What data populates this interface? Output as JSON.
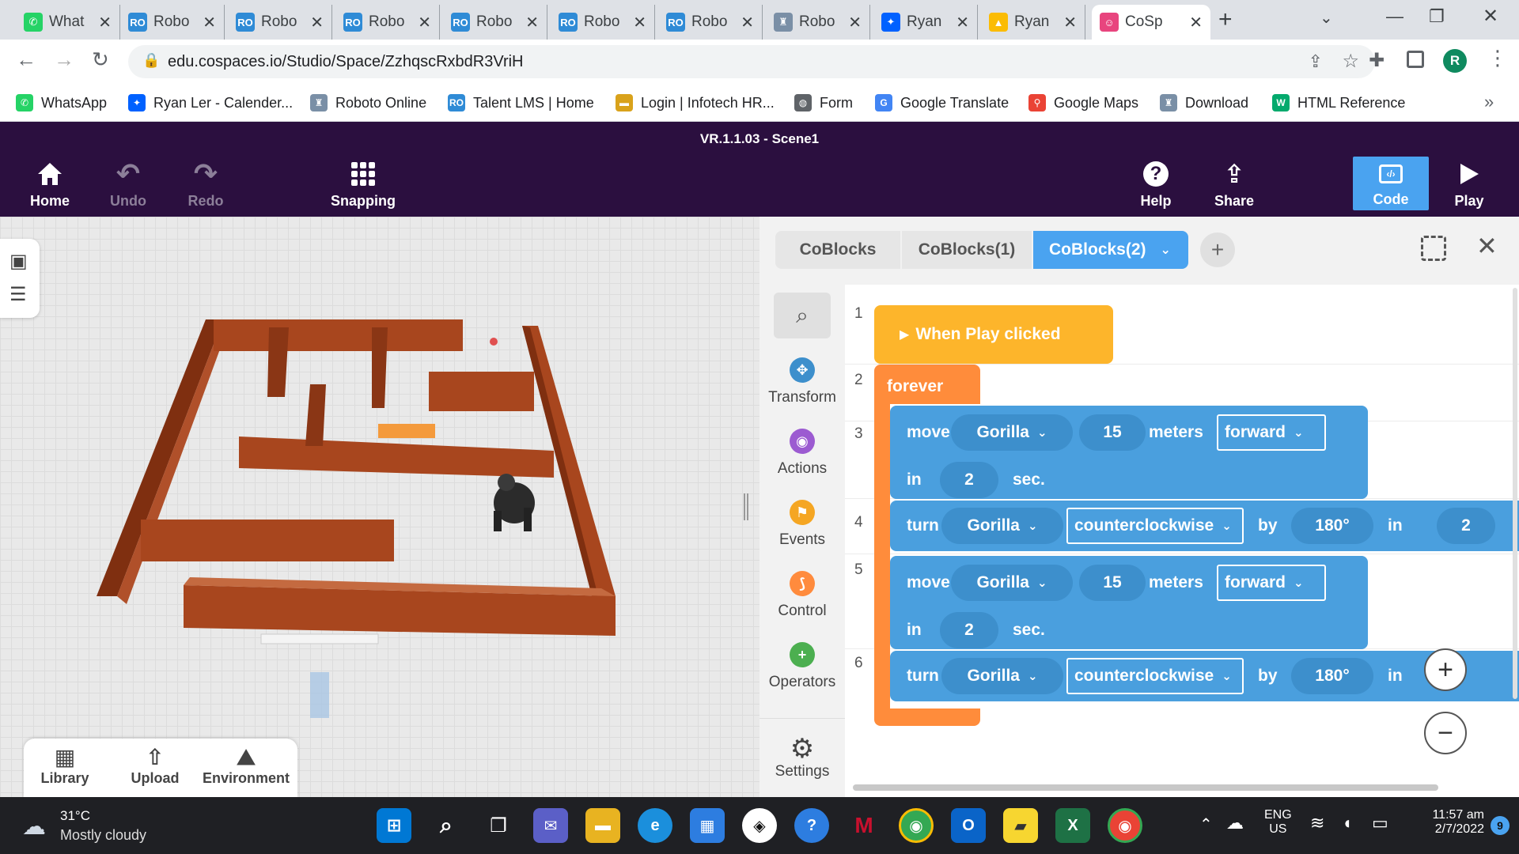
{
  "browser": {
    "tabs": [
      {
        "title": "What",
        "favicon": "whatsapp-icon",
        "color": "#25d366",
        "glyph": "✆"
      },
      {
        "title": "Robo",
        "favicon": "robocode-icon",
        "color": "#2f8bd6",
        "glyph": "RO"
      },
      {
        "title": "Robo",
        "favicon": "robocode-icon",
        "color": "#2f8bd6",
        "glyph": "RO"
      },
      {
        "title": "Robo",
        "favicon": "robocode-icon",
        "color": "#2f8bd6",
        "glyph": "RO"
      },
      {
        "title": "Robo",
        "favicon": "robocode-icon",
        "color": "#2f8bd6",
        "glyph": "RO"
      },
      {
        "title": "Robo",
        "favicon": "robocode-icon",
        "color": "#2f8bd6",
        "glyph": "RO"
      },
      {
        "title": "Robo",
        "favicon": "robocode-icon",
        "color": "#2f8bd6",
        "glyph": "RO"
      },
      {
        "title": "Robo",
        "favicon": "robot-icon",
        "color": "#7a8fa6",
        "glyph": "♜"
      },
      {
        "title": "Ryan",
        "favicon": "dropbox-icon",
        "color": "#0061ff",
        "glyph": "✦"
      },
      {
        "title": "Ryan",
        "favicon": "google-drive-icon",
        "color": "#fbbc04",
        "glyph": "▲"
      },
      {
        "title": "CoSp",
        "favicon": "cospaces-icon",
        "color": "#e8457e",
        "glyph": "☺",
        "active": true
      }
    ],
    "url": "edu.cospaces.io/Studio/Space/ZzhqscRxbdR3VriH",
    "profile_initial": "R",
    "bookmarks": [
      {
        "label": "WhatsApp",
        "icon": "whatsapp-icon",
        "color": "#25d366",
        "glyph": "✆"
      },
      {
        "label": "Ryan Ler - Calender...",
        "icon": "dropbox-icon",
        "color": "#0061ff",
        "glyph": "✦"
      },
      {
        "label": "Roboto Online",
        "icon": "robot-icon",
        "color": "#7a8fa6",
        "glyph": "♜"
      },
      {
        "label": "Talent LMS | Home",
        "icon": "robocode-icon",
        "color": "#2f8bd6",
        "glyph": "RO"
      },
      {
        "label": "Login | Infotech HR...",
        "icon": "infotech-icon",
        "color": "#d9a21b",
        "glyph": "▬"
      },
      {
        "label": "Form",
        "icon": "globe-icon",
        "color": "#5f6368",
        "glyph": "◍"
      },
      {
        "label": "Google Translate",
        "icon": "google-translate-icon",
        "color": "#4285f4",
        "glyph": "G"
      },
      {
        "label": "Google Maps",
        "icon": "google-maps-icon",
        "color": "#ea4335",
        "glyph": "⚲"
      },
      {
        "label": "Download",
        "icon": "robot-icon",
        "color": "#7a8fa6",
        "glyph": "♜"
      },
      {
        "label": "HTML Reference",
        "icon": "w3schools-icon",
        "color": "#04aa6d",
        "glyph": "W"
      }
    ]
  },
  "app": {
    "version_title": "VR.1.1.03 - Scene1",
    "header": {
      "home": "Home",
      "undo": "Undo",
      "redo": "Redo",
      "snapping": "Snapping",
      "help": "Help",
      "share": "Share",
      "code": "Code",
      "play": "Play"
    },
    "bottom_bar": {
      "library": "Library",
      "upload": "Upload",
      "environment": "Environment"
    },
    "code_tabs": [
      "CoBlocks",
      "CoBlocks(1)",
      "CoBlocks(2)"
    ],
    "palette": [
      {
        "label": "Transform",
        "color": "#3d8fcc",
        "glyph": "✥"
      },
      {
        "label": "Actions",
        "color": "#9c5bd1",
        "glyph": "◉"
      },
      {
        "label": "Events",
        "color": "#f5a623",
        "glyph": "⚑"
      },
      {
        "label": "Control",
        "color": "#ff8b3d",
        "glyph": "⟆"
      },
      {
        "label": "Operators",
        "color": "#4caf50",
        "glyph": "+"
      }
    ],
    "settings_label": "Settings",
    "line_numbers": [
      "1",
      "2",
      "3",
      "4",
      "5",
      "6"
    ],
    "blocks": {
      "event": "When Play clicked",
      "forever": "forever",
      "move1": {
        "verb": "move",
        "obj": "Gorilla",
        "dist": "15",
        "unit": "meters",
        "dir": "forward",
        "in": "in",
        "time": "2",
        "sec": "sec."
      },
      "turn1": {
        "verb": "turn",
        "obj": "Gorilla",
        "dir": "counterclockwise",
        "by": "by",
        "angle": "180°",
        "in": "in",
        "time": "2"
      },
      "move2": {
        "verb": "move",
        "obj": "Gorilla",
        "dist": "15",
        "unit": "meters",
        "dir": "forward",
        "in": "in",
        "time": "2",
        "sec": "sec."
      },
      "turn2": {
        "verb": "turn",
        "obj": "Gorilla",
        "dir": "counterclockwise",
        "by": "by",
        "angle": "180°",
        "in": "in"
      }
    },
    "colors": {
      "header_bg": "#2b0f3f",
      "code_accent": "#4aa3f0",
      "motion_block": "#4a9fde",
      "event_block": "#fdb52b",
      "control_block": "#ff8c3b",
      "wall": "#a8461e"
    }
  },
  "taskbar": {
    "weather_temp": "31°C",
    "weather_desc": "Mostly cloudy",
    "lang1": "ENG",
    "lang2": "US",
    "time": "11:57 am",
    "date": "2/7/2022",
    "notification_count": "9"
  }
}
